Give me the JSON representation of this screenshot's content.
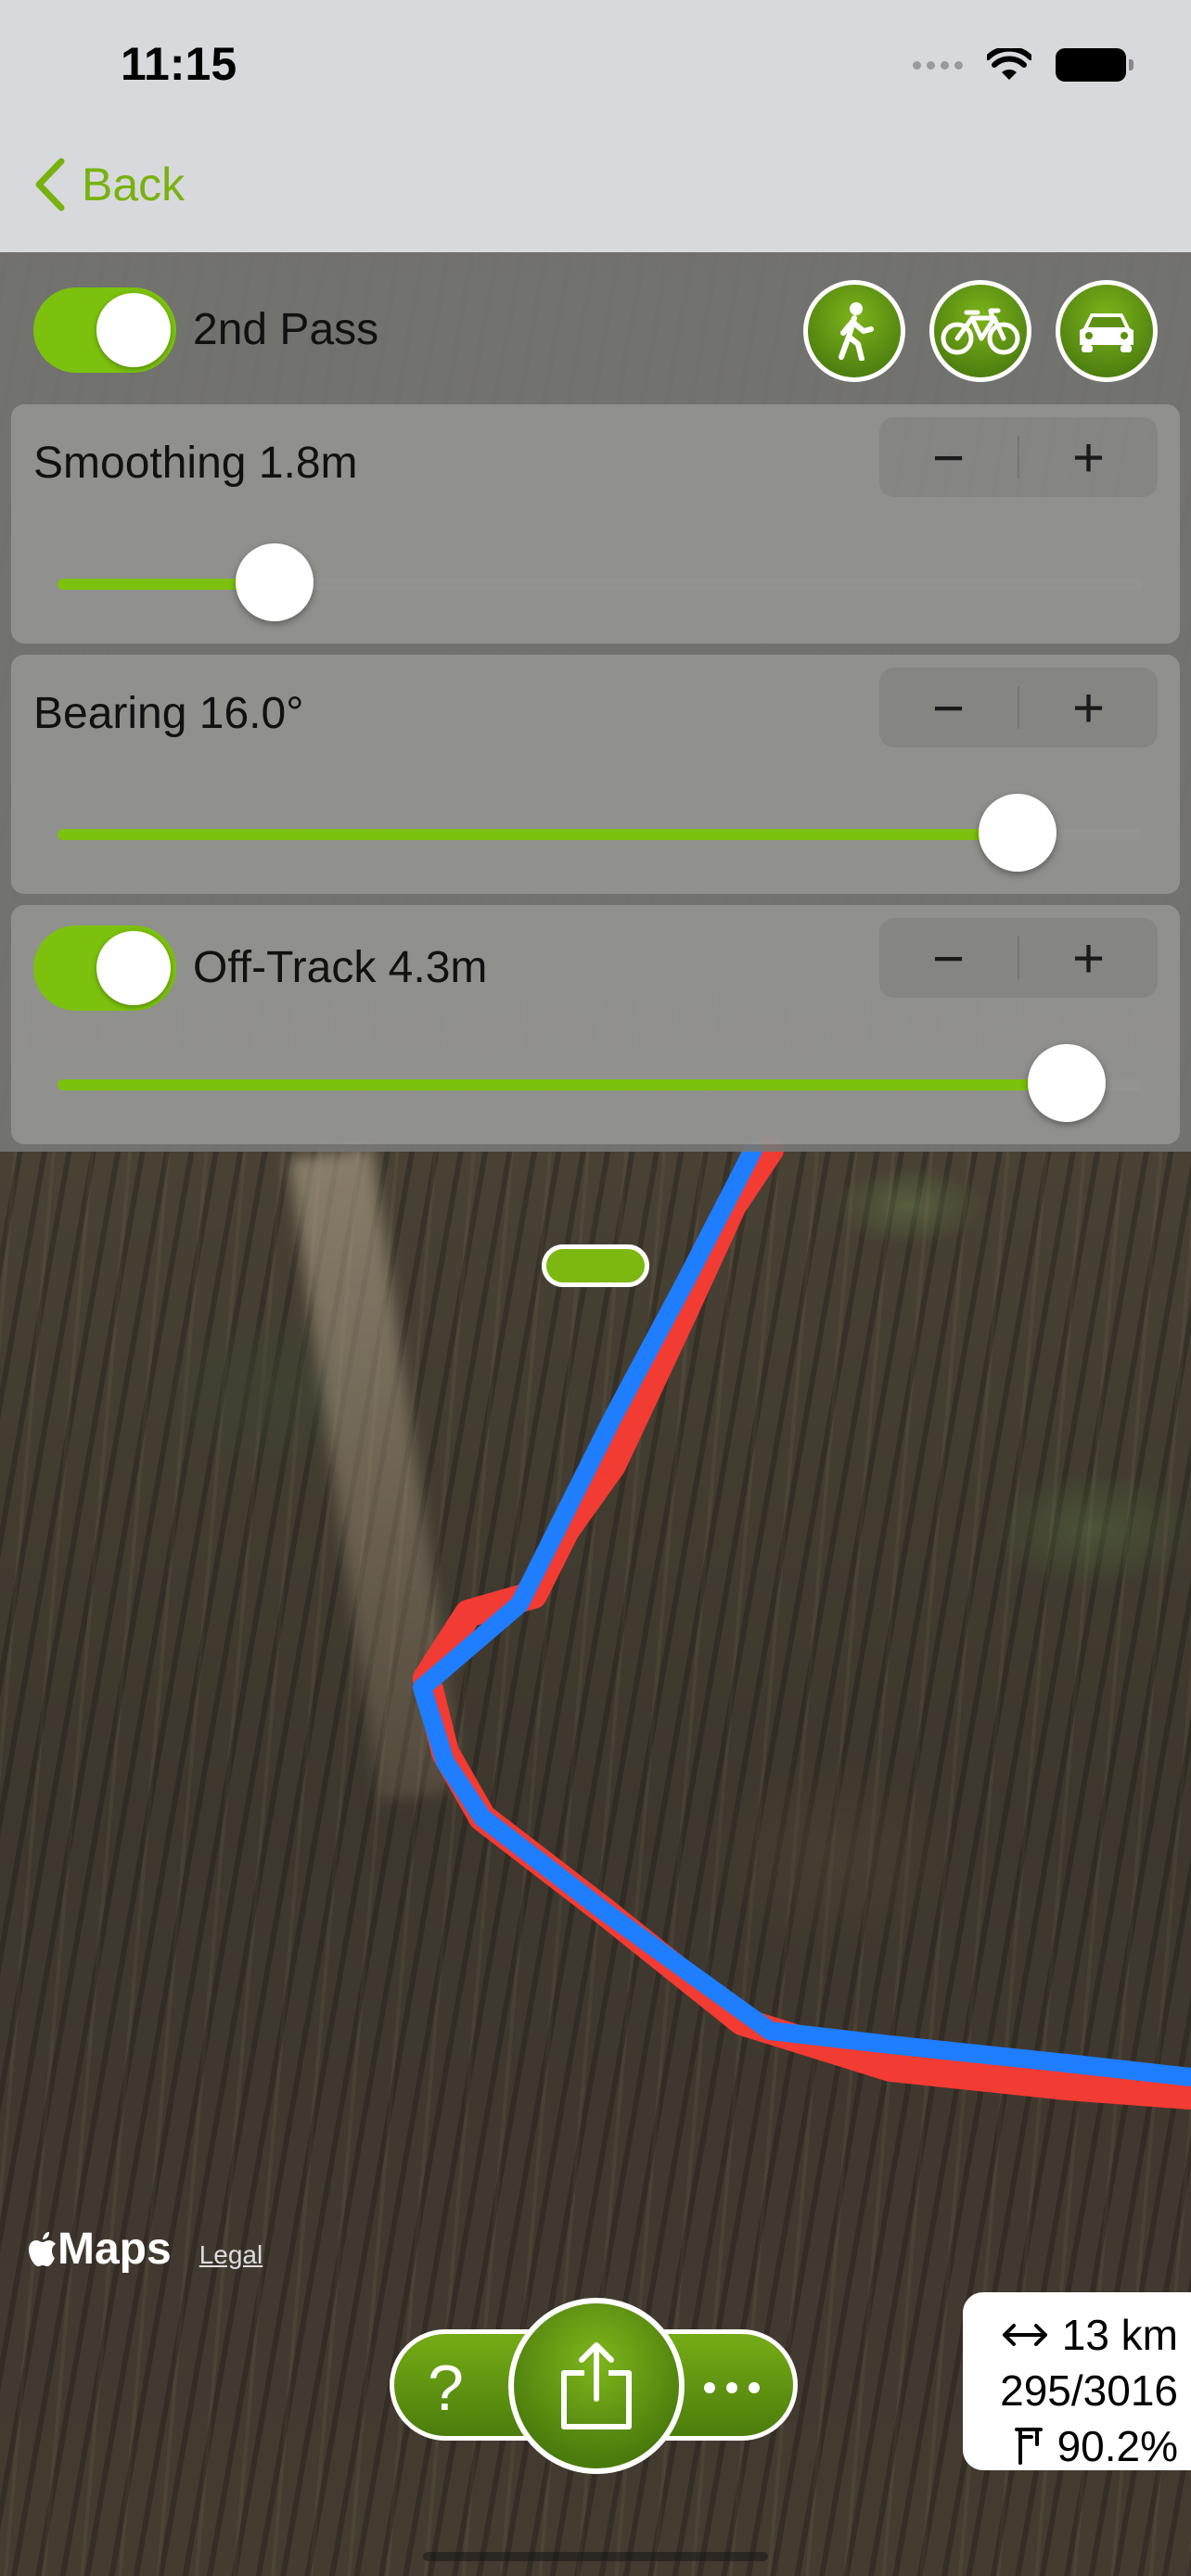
{
  "status_bar": {
    "time": "11:15"
  },
  "nav": {
    "back_label": "Back"
  },
  "colors": {
    "accent": "#7cc10d",
    "raw_track": "#f23b33",
    "matched_track": "#1f7dff"
  },
  "header": {
    "second_pass_label": "2nd Pass",
    "second_pass_on": true,
    "modes": [
      {
        "name": "walk",
        "icon": "walking-person-icon"
      },
      {
        "name": "bike",
        "icon": "bicycle-icon"
      },
      {
        "name": "car",
        "icon": "car-icon"
      }
    ]
  },
  "controls": {
    "smoothing": {
      "label": "Smoothing 1.8m",
      "minus": "−",
      "plus": "+",
      "value_fraction": 0.2
    },
    "bearing": {
      "label": "Bearing 16.0°",
      "minus": "−",
      "plus": "+",
      "value_fraction": 0.885
    },
    "off_track": {
      "label": "Off-Track 4.3m",
      "enabled": true,
      "minus": "−",
      "plus": "+",
      "value_fraction": 0.93
    }
  },
  "map": {
    "attribution": "Maps",
    "legal": "Legal"
  },
  "actions": {
    "help": "?"
  },
  "stats": {
    "distance": "13 km",
    "points": "295/3016",
    "ratio": "90.2%"
  }
}
